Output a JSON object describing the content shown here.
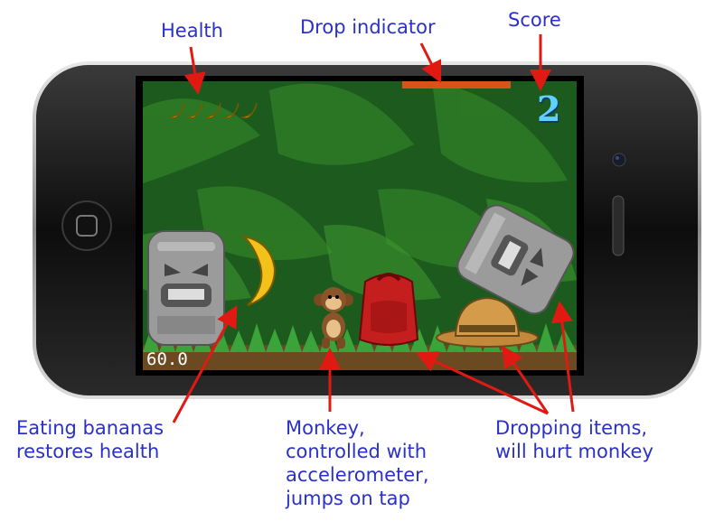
{
  "annotations": {
    "health": "Health",
    "drop_indicator": "Drop indicator",
    "score": "Score",
    "bananas_line1": "Eating bananas",
    "bananas_line2": "restores health",
    "monkey_line1": "Monkey,",
    "monkey_line2": "controlled with",
    "monkey_line3": "accelerometer,",
    "monkey_line4": "jumps on tap",
    "dropping_line1": "Dropping items,",
    "dropping_line2": "will hurt monkey"
  },
  "hud": {
    "score": "2",
    "timer": "60.0",
    "health_bananas": 5
  },
  "colors": {
    "annotation": "#2a31c9",
    "arrow": "#e01a12",
    "score": "#5fd0ff",
    "drop_indicator": "#d6541b"
  },
  "icons": {
    "health": "banana-icon",
    "monkey": "monkey-icon",
    "hazards": [
      "tiki-totem-icon",
      "backpack-icon",
      "safari-hat-icon"
    ],
    "pickup": "banana-icon"
  }
}
